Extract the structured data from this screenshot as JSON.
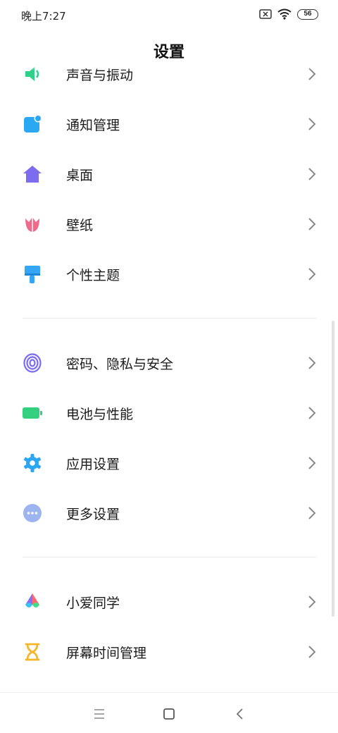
{
  "status_bar": {
    "time": "晚上7:27",
    "battery": "56",
    "icons": [
      "sim-x-icon",
      "wifi-icon",
      "battery-icon"
    ]
  },
  "header": {
    "title": "设置"
  },
  "items": [
    {
      "label": "声音与振动",
      "icon": "sound-icon",
      "color": "#2ed08a"
    },
    {
      "label": "通知管理",
      "icon": "notification-icon",
      "color": "#2aa8f2"
    },
    {
      "label": "桌面",
      "icon": "home-icon",
      "color": "#7b6cf0"
    },
    {
      "label": "壁纸",
      "icon": "wallpaper-tulip-icon",
      "color": "#f06a8c"
    },
    {
      "label": "个性主题",
      "icon": "theme-brush-icon",
      "color": "#34a6f5"
    },
    {
      "label": "密码、隐私与安全",
      "icon": "fingerprint-icon",
      "color": "#7a6cf2"
    },
    {
      "label": "电池与性能",
      "icon": "battery-icon",
      "color": "#33d07f"
    },
    {
      "label": "应用设置",
      "icon": "gear-icon",
      "color": "#2ba6f2"
    },
    {
      "label": "更多设置",
      "icon": "more-icon",
      "color": "#9eb4ee"
    },
    {
      "label": "小爱同学",
      "icon": "xiaoai-icon",
      "color": "#ff6a6a"
    },
    {
      "label": "屏幕时间管理",
      "icon": "hourglass-icon",
      "color": "#f6b62c"
    }
  ],
  "nav_bar": {
    "buttons": [
      "menu-icon",
      "home-square-icon",
      "back-icon"
    ]
  }
}
